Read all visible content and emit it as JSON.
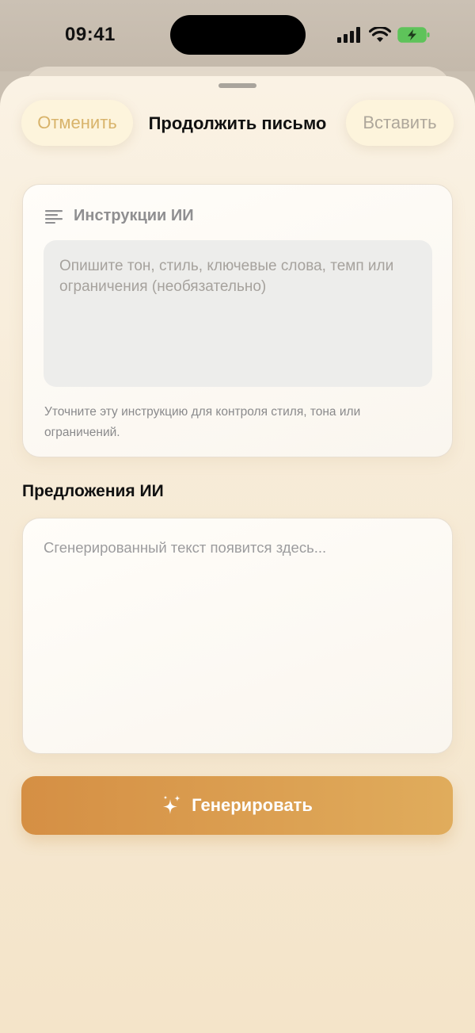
{
  "status": {
    "time": "09:41"
  },
  "header": {
    "cancel_label": "Отменить",
    "title": "Продолжить письмо",
    "insert_label": "Вставить"
  },
  "instructions": {
    "label": "Инструкции ИИ",
    "placeholder": "Опишите тон, стиль, ключевые слова, темп или ограничения (необязательно)",
    "hint": "Уточните эту инструкцию для контроля стиля, тона или ограничений."
  },
  "suggestions": {
    "title": "Предложения ИИ",
    "placeholder": "Сгенерированный текст появится здесь..."
  },
  "generate": {
    "label": "Генерировать"
  },
  "colors": {
    "accent": "#d8b36a",
    "button_gradient_start": "#d58f44",
    "button_gradient_end": "#e0ac5c"
  }
}
